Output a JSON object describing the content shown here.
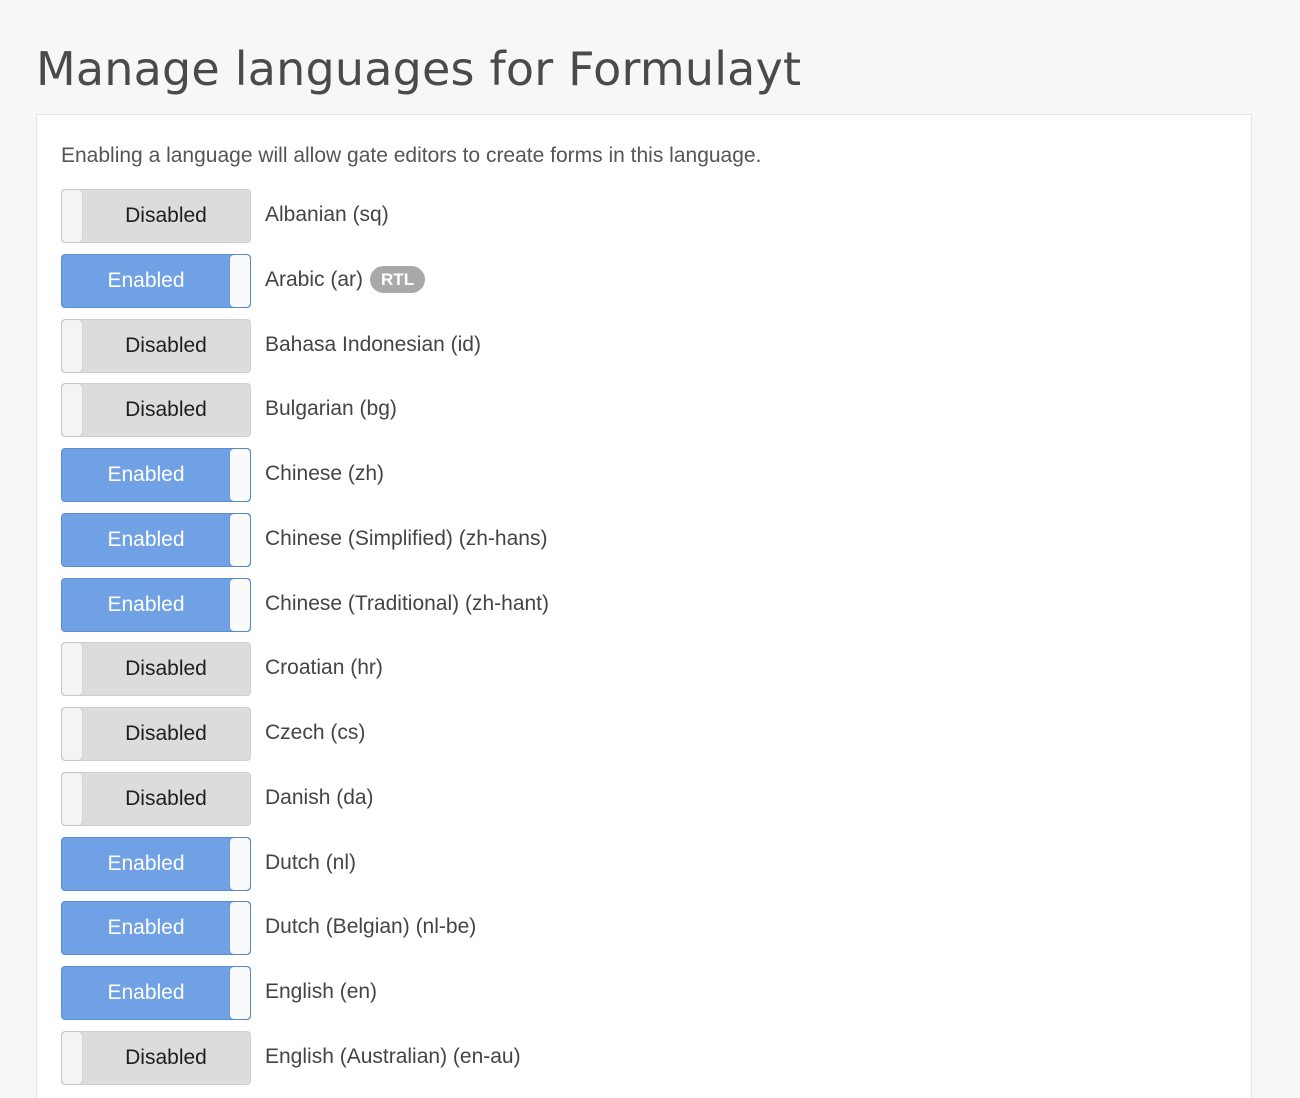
{
  "page": {
    "title": "Manage languages for Formulayt",
    "intro": "Enabling a language will allow gate editors to create forms in this language."
  },
  "toggle_labels": {
    "enabled": "Enabled",
    "disabled": "Disabled"
  },
  "colors": {
    "enabled_bg": "#6fa1e4",
    "disabled_bg": "#dcdcdc",
    "badge_bg": "#a9a9a9"
  },
  "languages": [
    {
      "label": "Albanian (sq)",
      "enabled": false
    },
    {
      "label": "Arabic (ar)",
      "enabled": true,
      "badge": "RTL"
    },
    {
      "label": "Bahasa Indonesian (id)",
      "enabled": false
    },
    {
      "label": "Bulgarian (bg)",
      "enabled": false
    },
    {
      "label": "Chinese (zh)",
      "enabled": true
    },
    {
      "label": "Chinese (Simplified) (zh-hans)",
      "enabled": true
    },
    {
      "label": "Chinese (Traditional) (zh-hant)",
      "enabled": true
    },
    {
      "label": "Croatian (hr)",
      "enabled": false
    },
    {
      "label": "Czech (cs)",
      "enabled": false
    },
    {
      "label": "Danish (da)",
      "enabled": false
    },
    {
      "label": "Dutch (nl)",
      "enabled": true
    },
    {
      "label": "Dutch (Belgian) (nl-be)",
      "enabled": true
    },
    {
      "label": "English (en)",
      "enabled": true
    },
    {
      "label": "English (Australian) (en-au)",
      "enabled": false
    }
  ]
}
